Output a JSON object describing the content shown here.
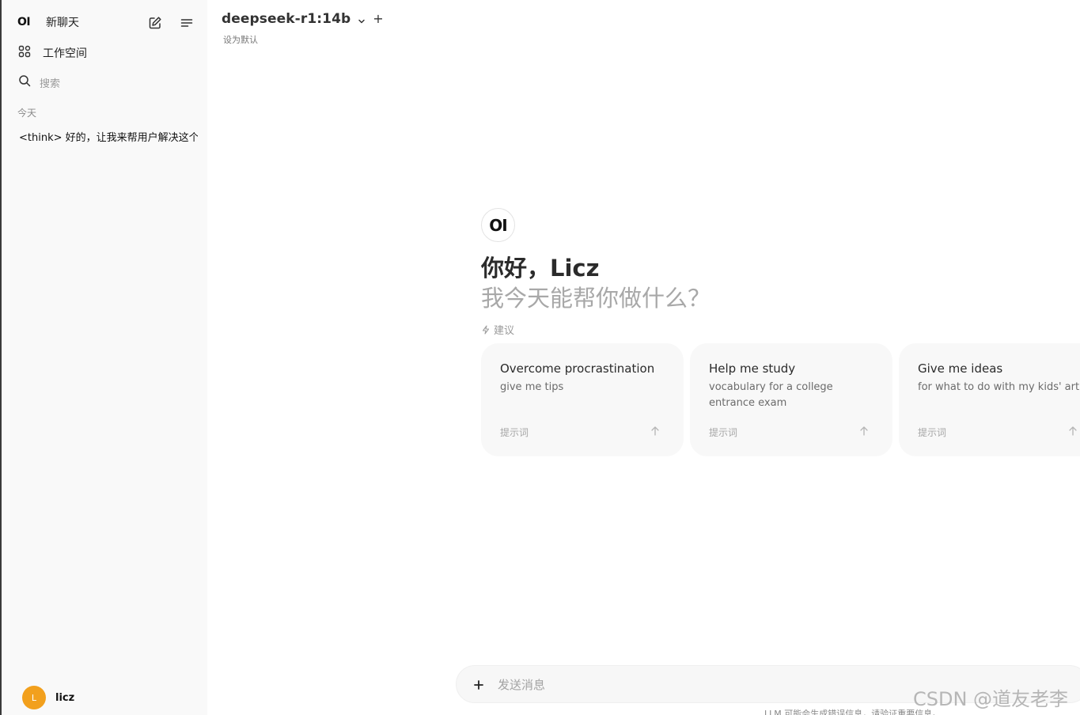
{
  "sidebar": {
    "logo": "OI",
    "new_chat": "新聊天",
    "workspace": "工作空间",
    "search_placeholder": "搜索",
    "section_today": "今天",
    "chats": [
      "<think> 好的，让我来帮用户解决这个"
    ],
    "user": {
      "initial": "L",
      "name": "licz",
      "avatar_color": "#f2a01d"
    },
    "icons": {
      "new_chat": "pencil-square-icon",
      "menu": "menu-lines-icon",
      "workspace": "grid-icon",
      "search": "search-icon"
    }
  },
  "header": {
    "model_name": "deepseek-r1:14b",
    "add": "+",
    "set_default": "设为默认"
  },
  "main": {
    "logo": "OI",
    "greeting": "你好，Licz",
    "subgreeting": "我今天能帮你做什么？",
    "suggestions_title": "建议",
    "cards": [
      {
        "title": "Overcome procrastination",
        "desc": "give me tips",
        "tag": "提示词"
      },
      {
        "title": "Help me study",
        "desc": "vocabulary for a college entrance exam",
        "tag": "提示词"
      },
      {
        "title": "Give me ideas",
        "desc": "for what to do with my kids' art",
        "tag": "提示词"
      }
    ]
  },
  "input": {
    "placeholder": "发送消息",
    "disclaimer": "LLM 可能会生成错误信息，请验证重要信息。"
  },
  "watermark": "CSDN @道友老李"
}
